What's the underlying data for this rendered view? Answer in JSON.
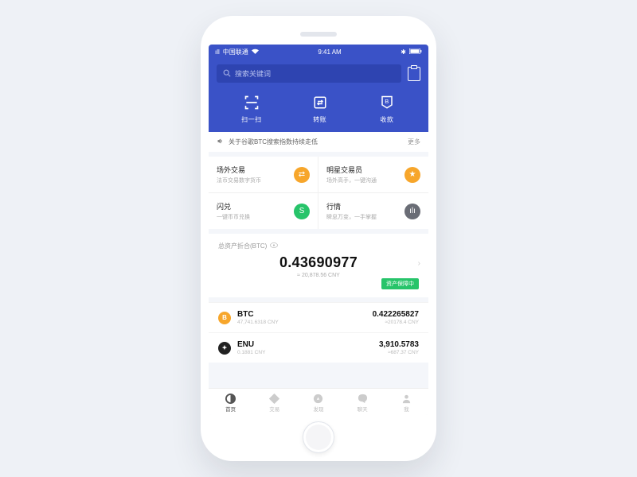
{
  "status": {
    "carrier": "中国联通",
    "time": "9:41 AM"
  },
  "search": {
    "placeholder": "搜索关键词"
  },
  "actions": {
    "scan": "扫一扫",
    "transfer": "转账",
    "receive": "收款"
  },
  "announce": {
    "text": "关于谷歌BTC搜索指数持续走低",
    "more": "更多"
  },
  "features": [
    {
      "title": "场外交易",
      "sub": "法币交易数字货币"
    },
    {
      "title": "明星交易员",
      "sub": "场外高手，一键沟通"
    },
    {
      "title": "闪兑",
      "sub": "一键币币兑换"
    },
    {
      "title": "行情",
      "sub": "瞬息万变，一手掌握"
    }
  ],
  "assets": {
    "label": "总资产折合(BTC)",
    "value": "0.43690977",
    "approx": "≈ 20,878.56 CNY",
    "protect": "资产保障中"
  },
  "coins": [
    {
      "sym": "BTC",
      "desc": "47,741.6318 CNY",
      "val": "0.422265827",
      "sub": "≈20178.4 CNY"
    },
    {
      "sym": "ENU",
      "desc": "0.1881 CNY",
      "val": "3,910.5783",
      "sub": "≈687.37 CNY"
    }
  ],
  "tabs": {
    "home": "首页",
    "trade": "交易",
    "discover": "发现",
    "chat": "聊天",
    "me": "我"
  }
}
